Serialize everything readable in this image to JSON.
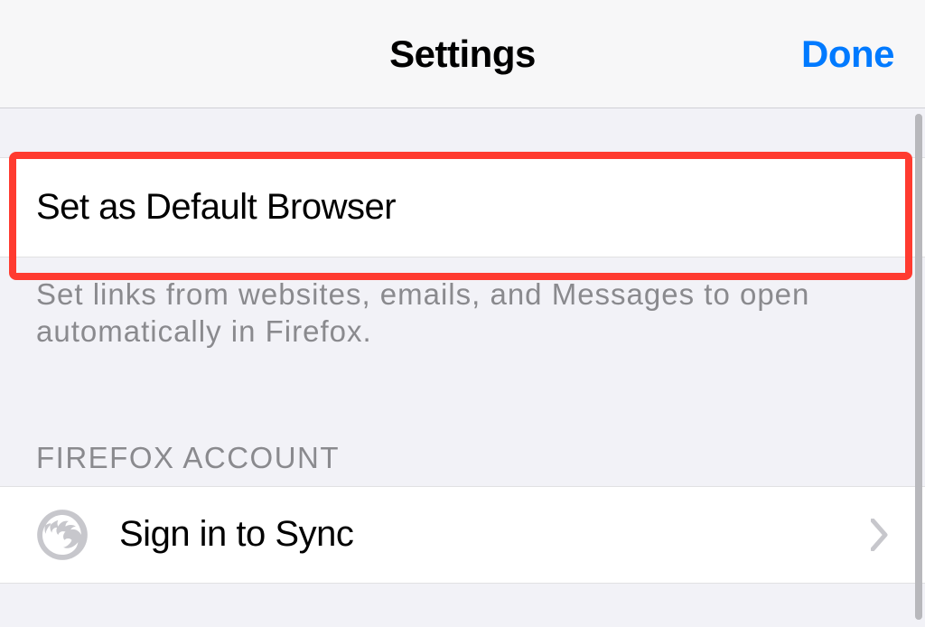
{
  "header": {
    "title": "Settings",
    "done_label": "Done"
  },
  "default_browser": {
    "label": "Set as Default Browser",
    "description": "Set links from websites, emails, and Messages to open automatically in Firefox."
  },
  "account": {
    "section_header": "FIREFOX ACCOUNT",
    "sign_in_label": "Sign in to Sync"
  }
}
